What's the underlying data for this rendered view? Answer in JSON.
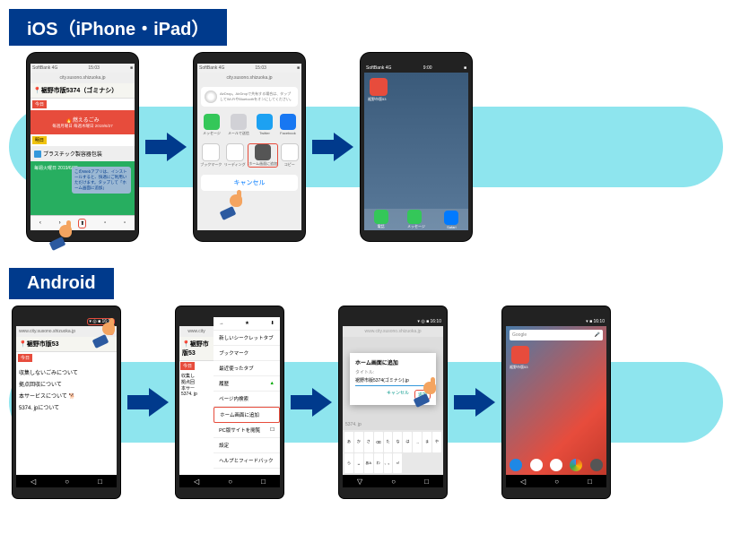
{
  "sections": {
    "ios": {
      "title": "iOS（iPhone・iPad）"
    },
    "android": {
      "title": "Android"
    }
  },
  "common": {
    "carrier": "SoftBank 4G",
    "time_ios": "15:03",
    "url": "city.susono.shizuoka.jp",
    "app_title": "裾野市版5374（ゴミナシ）",
    "app_title_short": "裾野市版53",
    "today_tag": "今日",
    "burnable": "🔥燃えるごみ",
    "burnable_sub": "毎週月曜日 毎週木曜日 2019/6/27",
    "tomorrow_tag": "明日",
    "plastic": "プラスチック製容器包装",
    "week_tag": "毎週火曜日 2019/6/28",
    "tooltip": "このWebアプリは、インストールすると、快適にご利用いただけます。タップして「ホーム画面に追加」"
  },
  "share": {
    "airdrop": "AirDrop。AirDropで共有する場合は、タップしてWi-FiやBluetoothをオンにしてください。",
    "items1": [
      "メッセージ",
      "メールで送信",
      "Twitter",
      "Facebook"
    ],
    "items2": [
      "ブックマーク",
      "リーディング",
      "ホーム画面",
      "コピー"
    ],
    "add_home": "ホーム画面に追加",
    "cancel": "キャンセル",
    "home_label": "裾野市版53"
  },
  "ios_dock": {
    "phone": "電話",
    "msg": "メッセージ",
    "safari": "Safari"
  },
  "android": {
    "time": "16:10",
    "url": "www.city.susono.shizuoka.jp",
    "content": [
      "収集しないごみについて",
      "拠点回収について",
      "本サービスについて 🐕",
      "5374. jpについて"
    ],
    "content_short": [
      "収集し",
      "拠点回",
      "本サー",
      "5374. jp"
    ],
    "menu": [
      "新しいシークレットタブ",
      "ブックマーク",
      "最近使ったタブ",
      "履歴",
      "ページ内検索",
      "ホーム画面に追加",
      "PC版サイトを閲覧",
      "設定",
      "ヘルプとフィードバック"
    ],
    "more_icon": "⋮",
    "dialog": {
      "title": "ホーム画面に追加",
      "label": "タイトル:",
      "field": "裾野市版5374(ゴミナシ).jp",
      "cancel": "キャンセル",
      "add": "追加"
    },
    "keys": [
      "あ",
      "か",
      "さ",
      "た",
      "な",
      "は",
      "ま",
      "や",
      "ら",
      "わ"
    ],
    "search": "Google",
    "mic": "🎤"
  }
}
